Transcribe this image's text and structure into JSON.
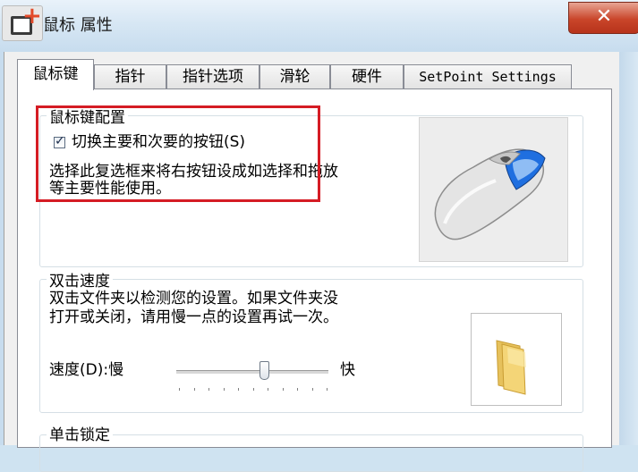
{
  "window": {
    "title": "鼠标 属性",
    "close_glyph": "✕"
  },
  "tabs": [
    {
      "label": "鼠标键",
      "active": true
    },
    {
      "label": "指针",
      "active": false
    },
    {
      "label": "指针选项",
      "active": false
    },
    {
      "label": "滑轮",
      "active": false
    },
    {
      "label": "硬件",
      "active": false
    },
    {
      "label": "SetPoint Settings",
      "active": false
    }
  ],
  "button_config": {
    "group_label": "鼠标键配置",
    "checkbox_label": "切换主要和次要的按钮(S)",
    "checkbox_checked": true,
    "description_line1": "选择此复选框来将右按钮设成如选择和拖放",
    "description_line2": "等主要性能使用。"
  },
  "double_click": {
    "group_label": "双击速度",
    "description_line1": "双击文件夹以检测您的设置。如果文件夹没",
    "description_line2": "打开或关闭，请用慢一点的设置再试一次。",
    "speed_label": "速度(D):慢",
    "fast_label": "快",
    "speed_value": 0.58
  },
  "click_lock": {
    "group_label": "单击锁定"
  },
  "colors": {
    "highlight": "#d51c24",
    "mouse_accent": "#1f6fe0",
    "folder": "#f4d577"
  },
  "icons": {
    "app": "app-add-icon",
    "mouse_preview": "mouse-icon",
    "folder_preview": "folder-icon"
  }
}
